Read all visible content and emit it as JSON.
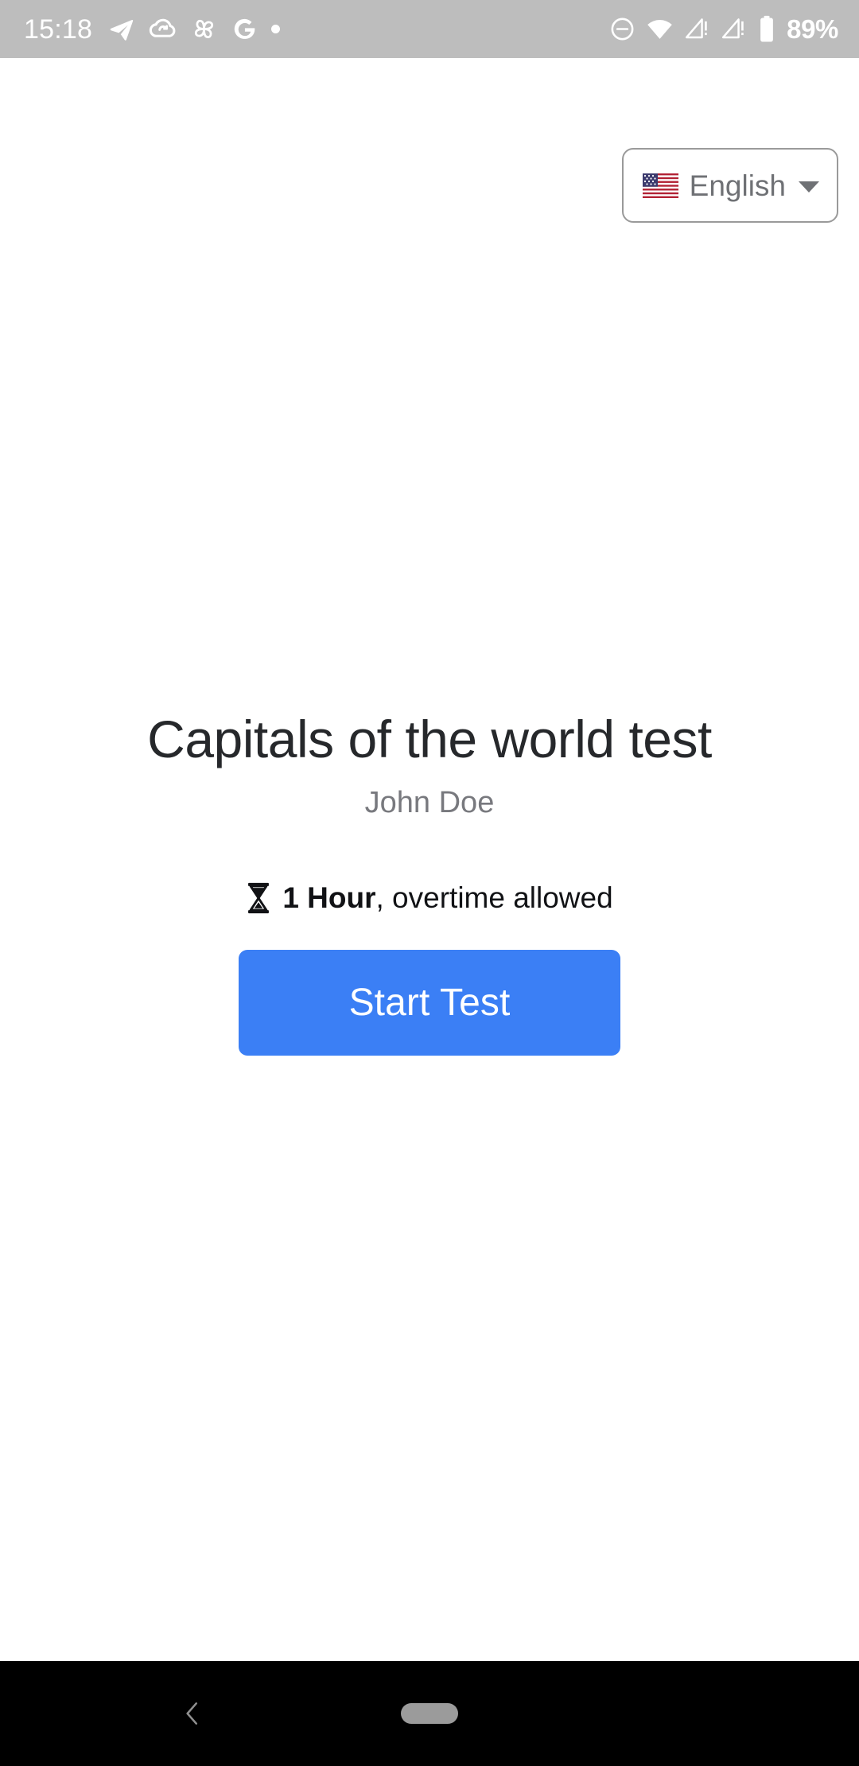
{
  "status_bar": {
    "time": "15:18",
    "battery_percent": "89%",
    "left_icons": [
      "telegram-icon",
      "cloud-sync-icon",
      "pinwheel-icon",
      "google-g-icon",
      "notification-dot-icon"
    ],
    "right_icons": [
      "do-not-disturb-icon",
      "wifi-icon",
      "mobile-signal-alert-icon",
      "mobile-signal-alert-2-icon",
      "battery-icon"
    ],
    "colors": {
      "background": "#bdbdbd",
      "foreground": "#ffffff"
    }
  },
  "language_selector": {
    "flag": "🇺🇸",
    "label": "English",
    "caret_icon": "chevron-down-icon"
  },
  "test": {
    "title": "Capitals of the world test",
    "author": "John Doe",
    "duration_icon": "hourglass-icon",
    "duration_value": "1 Hour",
    "duration_note": ", overtime allowed",
    "start_button_label": "Start Test"
  },
  "colors": {
    "accent": "#3b7ff5",
    "title_text": "#26282b",
    "muted_text": "#78797e",
    "body_text": "#111215",
    "page_background": "#ffffff",
    "nav_background": "#000000"
  },
  "nav_bar": {
    "back_icon": "back-chevron-icon",
    "home_pill_icon": "home-gesture-pill-icon"
  }
}
